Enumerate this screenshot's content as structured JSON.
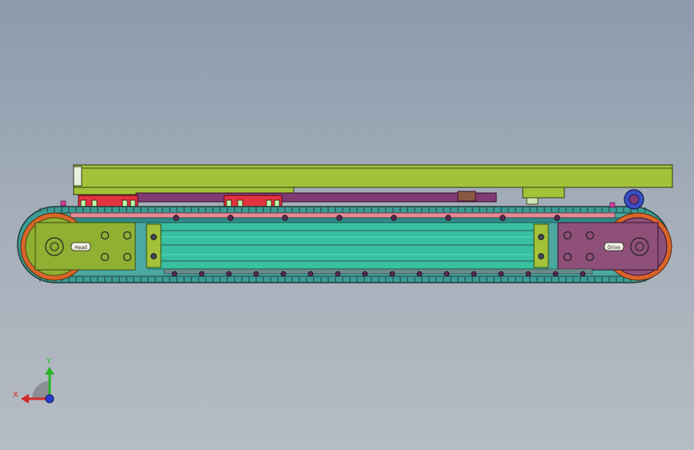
{
  "viewport": {
    "background_top": "#8c9aac",
    "background_bottom": "#b6bcc4"
  },
  "model": {
    "plate_left_label": "Head",
    "plate_right_label": "Drive",
    "colors": {
      "track": "#3b9c96",
      "track_dark": "#1f5a57",
      "sprocket_orange": "#d9652a",
      "side_plate_green": "#8fb033",
      "side_plate_purple": "#8e4f78",
      "rail_teal": "#38c0a0",
      "rail_light": "#62dbbd",
      "top_beam": "#a3c23a",
      "red_block": "#e23340",
      "pink_strip": "#e58a96",
      "purple_bar": "#7f3b72",
      "roller_blue": "#3a4fc4"
    }
  },
  "triad": {
    "x_label": "X",
    "y_label": "Y",
    "x_color": "#d42a2a",
    "y_color": "#2ab32a",
    "z_color": "#2a3ad4"
  }
}
